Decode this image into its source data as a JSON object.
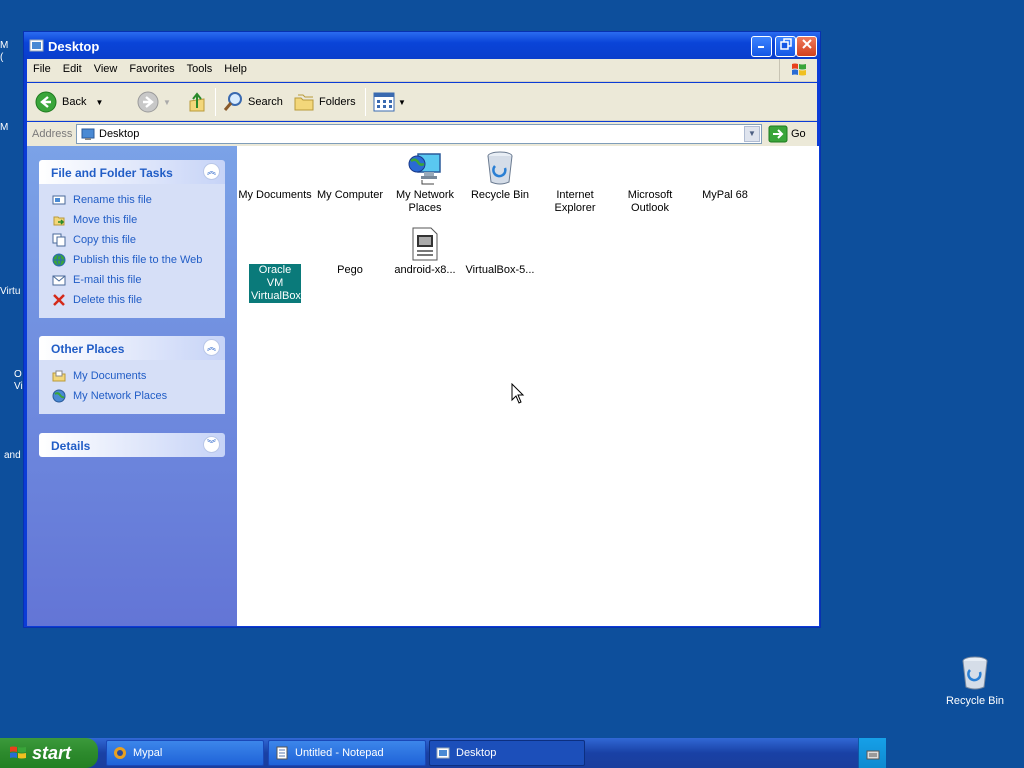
{
  "window": {
    "title": "Desktop",
    "menu": [
      "File",
      "Edit",
      "View",
      "Favorites",
      "Tools",
      "Help"
    ],
    "toolbar": {
      "back_label": "Back",
      "search_label": "Search",
      "folders_label": "Folders"
    },
    "address": {
      "label": "Address",
      "value": "Desktop",
      "go_label": "Go"
    }
  },
  "left_pane": {
    "file_tasks": {
      "title": "File and Folder Tasks",
      "items": [
        "Rename this file",
        "Move this file",
        "Copy this file",
        "Publish this file to the Web",
        "E-mail this file",
        "Delete this file"
      ]
    },
    "other_places": {
      "title": "Other Places",
      "items": [
        "My Documents",
        "My Network Places"
      ]
    },
    "details": {
      "title": "Details"
    }
  },
  "content": {
    "items": [
      {
        "label": "My Documents"
      },
      {
        "label": "My Computer"
      },
      {
        "label": "My Network Places"
      },
      {
        "label": "Recycle Bin"
      },
      {
        "label": "Internet Explorer"
      },
      {
        "label": "Microsoft Outlook"
      },
      {
        "label": "MyPal 68"
      },
      {
        "label": "Oracle VM VirtualBox"
      },
      {
        "label": "Pego"
      },
      {
        "label": "android-x8..."
      },
      {
        "label": "VirtualBox-5..."
      }
    ]
  },
  "desktop": {
    "recycle_bin_label": "Recycle Bin",
    "left_fragments": [
      "M",
      "(",
      "M",
      "Virtu",
      "O",
      "Vi",
      "and"
    ]
  },
  "taskbar": {
    "start_label": "start",
    "items": [
      "Mypal",
      "Untitled - Notepad",
      "Desktop"
    ]
  }
}
